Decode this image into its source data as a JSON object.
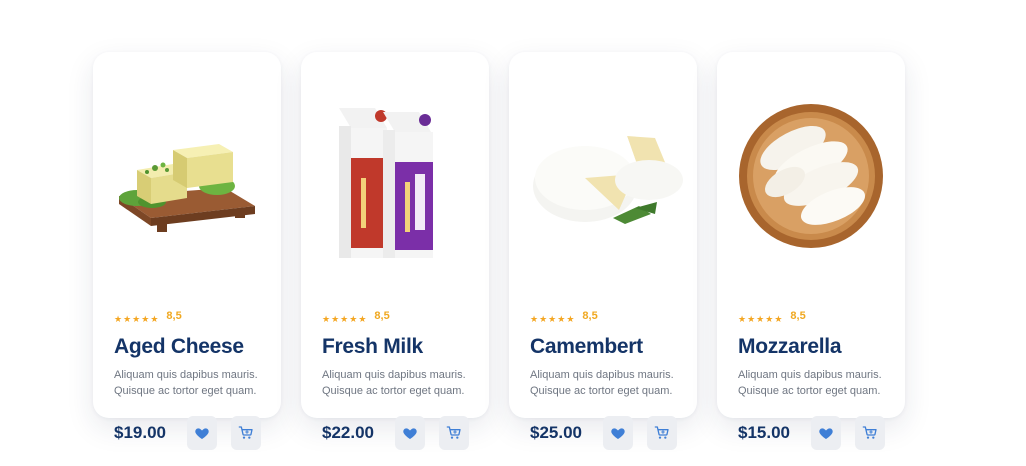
{
  "products": [
    {
      "image_icon": "aged-cheese-image",
      "stars": [
        "★",
        "★",
        "★",
        "★",
        "★"
      ],
      "rating": "8,5",
      "name": "Aged Cheese",
      "desc_line1": "Aliquam quis dapibus mauris.",
      "desc_line2": "Quisque ac tortor eget quam.",
      "price": "$19.00"
    },
    {
      "image_icon": "fresh-milk-image",
      "stars": [
        "★",
        "★",
        "★",
        "★",
        "★"
      ],
      "rating": "8,5",
      "name": "Fresh Milk",
      "desc_line1": "Aliquam quis dapibus mauris.",
      "desc_line2": "Quisque ac tortor eget quam.",
      "price": "$22.00"
    },
    {
      "image_icon": "camembert-image",
      "stars": [
        "★",
        "★",
        "★",
        "★",
        "★"
      ],
      "rating": "8,5",
      "name": "Camembert",
      "desc_line1": "Aliquam quis dapibus mauris.",
      "desc_line2": "Quisque ac tortor eget quam.",
      "price": "$25.00"
    },
    {
      "image_icon": "mozzarella-image",
      "stars": [
        "★",
        "★",
        "★",
        "★",
        "★"
      ],
      "rating": "8,5",
      "name": "Mozzarella",
      "desc_line1": "Aliquam quis dapibus mauris.",
      "desc_line2": "Quisque ac tortor eget quam.",
      "price": "$15.00"
    }
  ],
  "actions": {
    "favorite_icon": "heart-icon",
    "cart_icon": "cart-icon"
  },
  "colors": {
    "title": "#143467",
    "price": "#143467",
    "star": "#f4a622",
    "rating": "#f0a820",
    "icon": "#3f7fd6",
    "button_bg": "#eceef2",
    "description": "#6f7682"
  }
}
